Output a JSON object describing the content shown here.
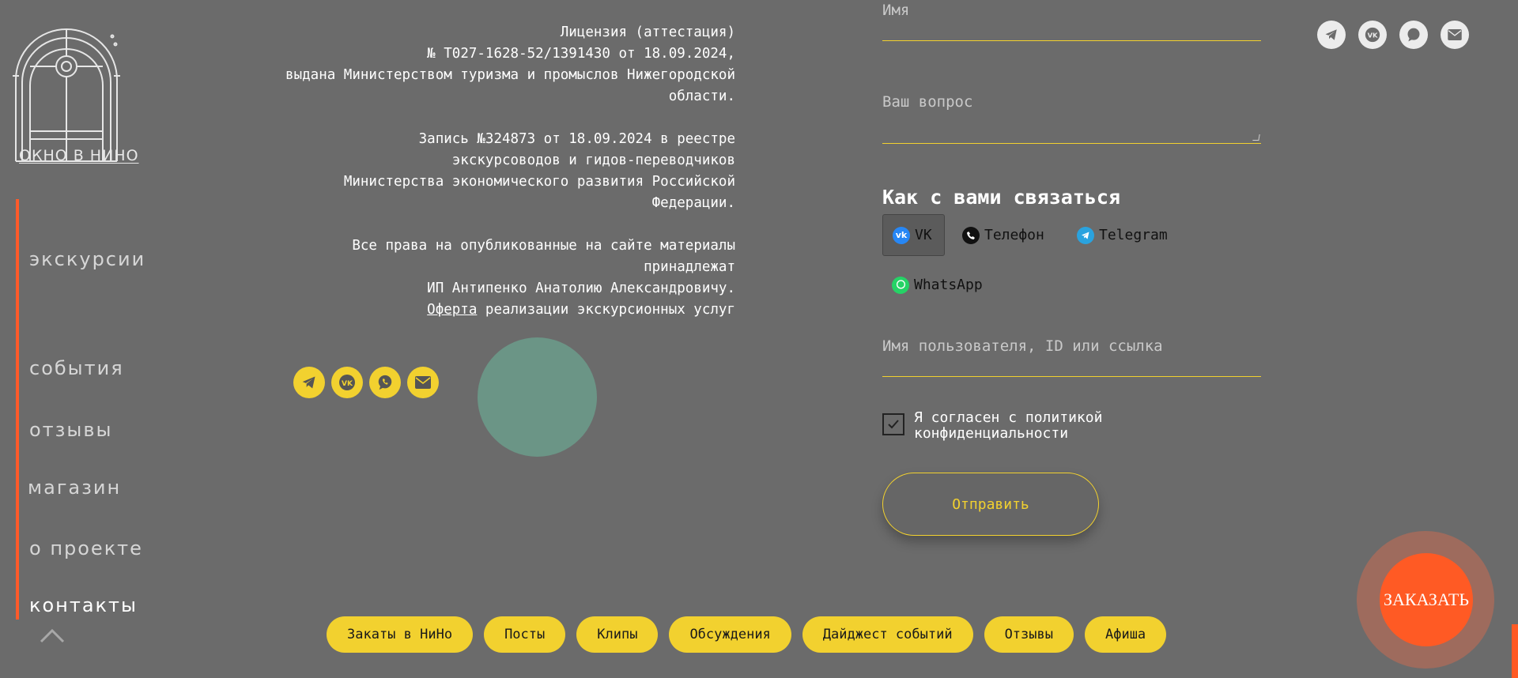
{
  "logo": {
    "text": "ОКНО В НИНО"
  },
  "nav": {
    "items": [
      {
        "label": "экскурсии"
      },
      {
        "label": "события"
      },
      {
        "label": "отзывы"
      },
      {
        "label": "магазин"
      },
      {
        "label": "о проекте"
      },
      {
        "label": "контакты"
      }
    ],
    "active": "контакты"
  },
  "license": {
    "p1": [
      "Лицензия (аттестация)",
      "№ Т027-1628-52/1391430 от 18.09.2024,",
      "выдана Министерством туризма и промыслов Нижегородской",
      "области."
    ],
    "p2": [
      "Запись №324873 от 18.09.2024 в реестре",
      "экскурсоводов и гидов-переводчиков",
      "Министерства экономического развития Российской",
      "Федерации."
    ],
    "p3": [
      "Все права на опубликованные на сайте материалы",
      "принадлежат",
      "ИП Антипенко Анатолию Александровичу."
    ],
    "offer_link": "Оферта",
    "offer_rest": " реализации экскурсионных услуг"
  },
  "form": {
    "name_placeholder": "Имя",
    "question_placeholder": "Ваш вопрос",
    "contact_title": "Как с вами связаться",
    "methods": [
      {
        "label": "VK",
        "icon": "vk-icon",
        "color": "#2787f5"
      },
      {
        "label": "Телефон",
        "icon": "phone-icon",
        "color": "#111111"
      },
      {
        "label": "Telegram",
        "icon": "telegram-icon",
        "color": "#2aa3df"
      },
      {
        "label": "WhatsApp",
        "icon": "whatsapp-icon",
        "color": "#25d366"
      }
    ],
    "selected_method": "VK",
    "user_placeholder": "Имя пользователя, ID или ссылка",
    "consent_line1": "Я согласен с политикой",
    "consent_line2": "конфиденциальности",
    "consent_checked": true,
    "submit_label": "Отправить"
  },
  "order_button": "ЗАКАЗАТЬ",
  "pills": [
    "Закаты в НиНо",
    "Посты",
    "Клипы",
    "Обсуждения",
    "Дайджест событий",
    "Отзывы",
    "Афиша"
  ],
  "colors": {
    "accent_yellow": "#f2d12f",
    "accent_orange": "#ff5a24",
    "background": "#6b6b6b"
  }
}
